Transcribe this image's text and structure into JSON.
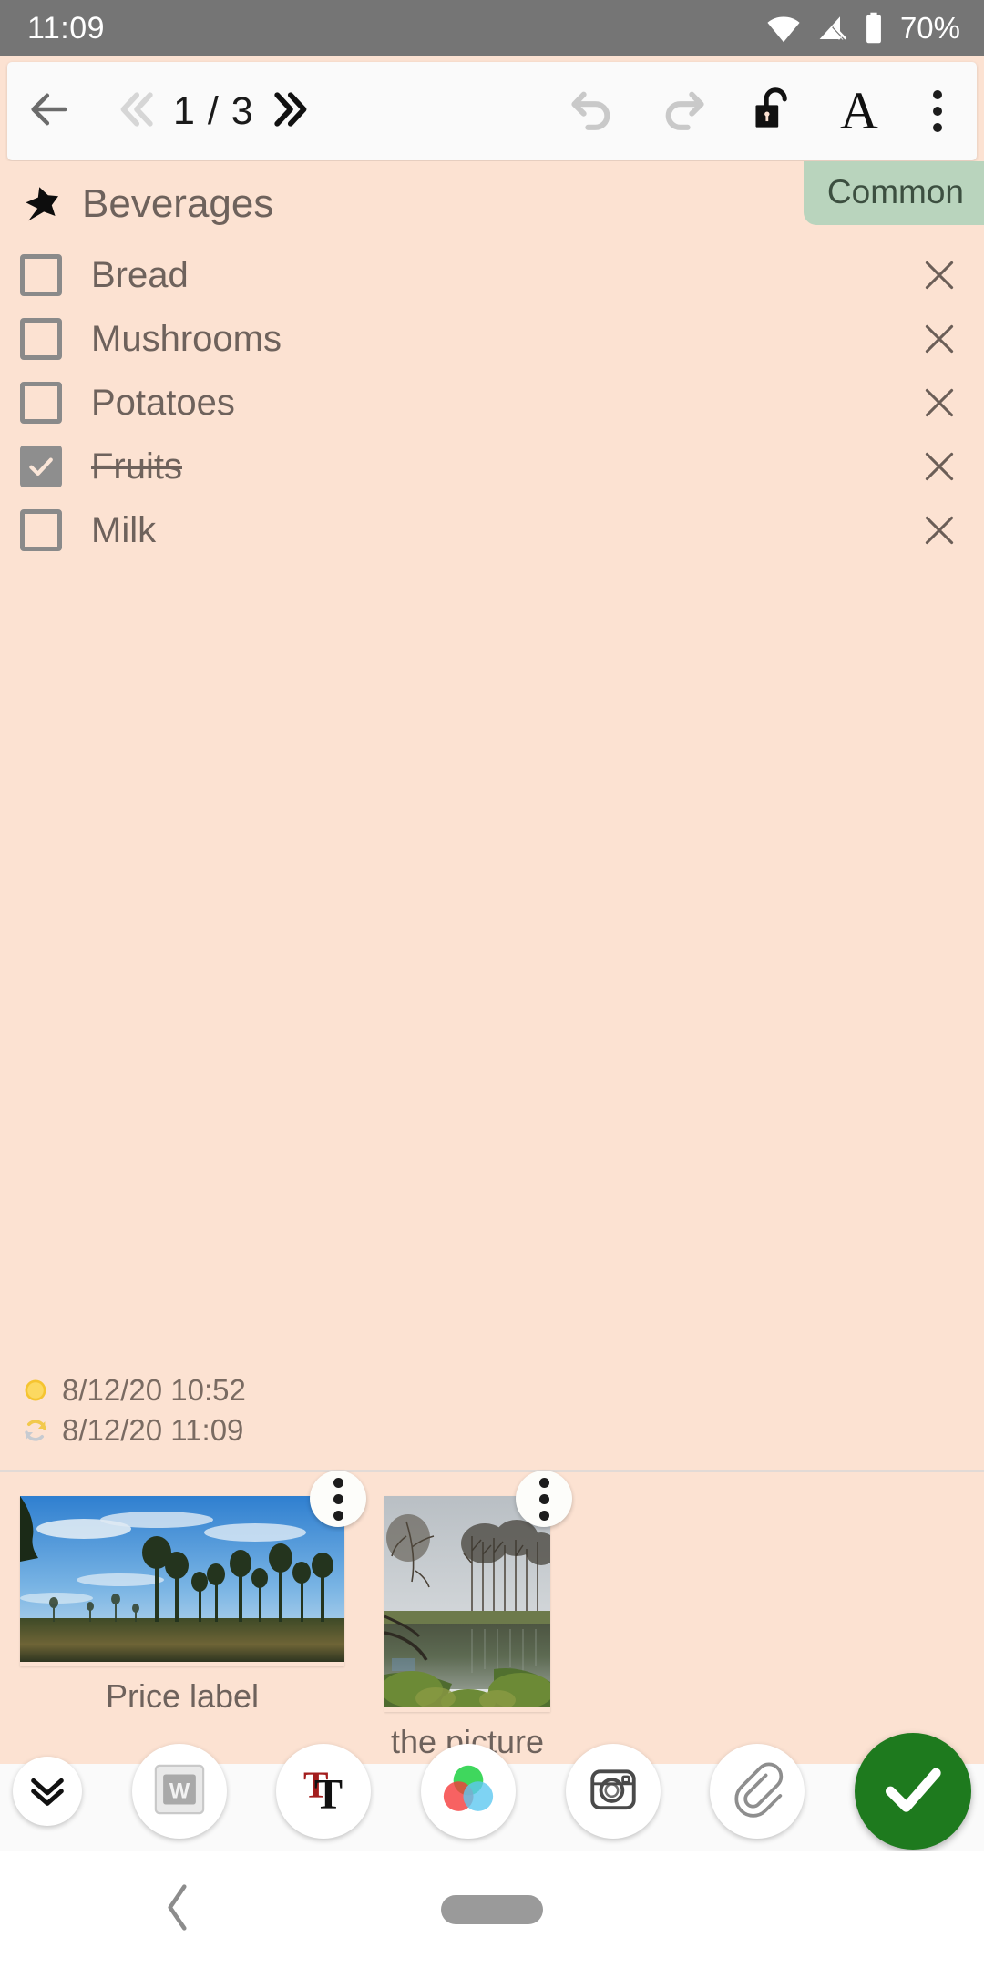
{
  "statusbar": {
    "clock": "11:09",
    "battery_text": "70%",
    "wifi_icon": "wifi-icon",
    "cellular_icon": "cellular-no-signal-icon",
    "battery_icon": "battery-icon"
  },
  "toolbar": {
    "back_icon": "arrow-left-icon",
    "prev_page_icon": "double-chevron-left-icon",
    "page_label": "1 / 3",
    "next_page_icon": "double-chevron-right-icon",
    "undo_icon": "undo-icon",
    "redo_icon": "redo-icon",
    "lock_icon": "unlocked-padlock-icon",
    "font_icon": "font-letter-a-icon",
    "overflow_icon": "three-dots-vertical-icon"
  },
  "note": {
    "tag_label": "Common",
    "pin_icon": "pushpin-icon",
    "title": "Beverages",
    "checklist": [
      {
        "label": "Bread",
        "checked": false,
        "delete_icon": "close-x-icon"
      },
      {
        "label": "Mushrooms",
        "checked": false,
        "delete_icon": "close-x-icon"
      },
      {
        "label": "Potatoes",
        "checked": false,
        "delete_icon": "close-x-icon"
      },
      {
        "label": "Fruits",
        "checked": true,
        "delete_icon": "close-x-icon"
      },
      {
        "label": "Milk",
        "checked": false,
        "delete_icon": "close-x-icon"
      }
    ],
    "created_icon": "sun-icon",
    "created": "8/12/20 10:52",
    "modified_icon": "refresh-arrows-icon",
    "modified": "8/12/20 11:09"
  },
  "attachments": [
    {
      "caption": "Price label",
      "menu_icon": "three-dots-vertical-icon",
      "kind": "landscape-photo"
    },
    {
      "caption": "the picture",
      "menu_icon": "three-dots-vertical-icon",
      "kind": "portrait-photo"
    }
  ],
  "actionbar": {
    "collapse_icon": "double-chevron-down-icon",
    "document_icon": "word-document-icon",
    "text_icon": "double-t-text-icon",
    "color_icon": "rgb-color-circles-icon",
    "camera_icon": "camera-icon",
    "attach_icon": "paperclip-icon",
    "confirm_icon": "checkmark-icon"
  },
  "navbar": {
    "back_icon": "nav-back-chevron-icon",
    "home_icon": "nav-home-pill-icon"
  },
  "colors": {
    "note_background": "#fce2d2",
    "tag_background": "#b9d4bd",
    "text": "#6e625c",
    "confirm_green": "#1e7a1e",
    "statusbar": "#757575"
  }
}
